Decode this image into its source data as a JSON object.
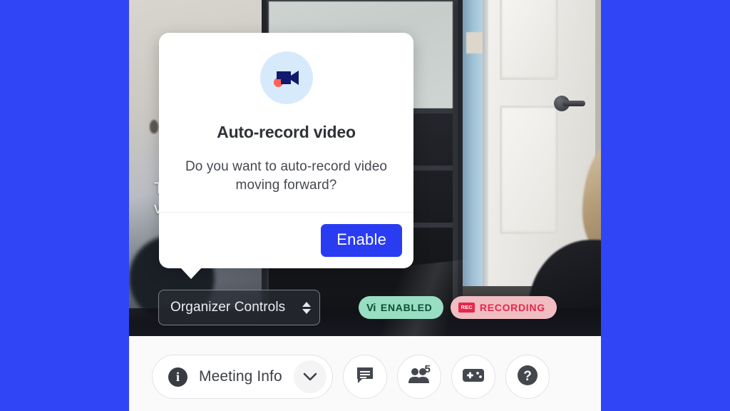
{
  "theme": {
    "letterbox_color": "#3045F5",
    "accent_blue": "#2a3cf2",
    "enabled_badge_bg": "#98dec3",
    "enabled_badge_fg": "#0d4d39",
    "recording_badge_bg": "#f0bdc2",
    "recording_badge_fg": "#e8274a",
    "dialog_icon_bg": "#d7eafc",
    "toolbar_bg": "#fafafa"
  },
  "video": {
    "obscured_caption_line1": "T",
    "obscured_caption_line2": "v"
  },
  "dialog": {
    "icon_name": "video-camera-record-icon",
    "title": "Auto-record video",
    "body": "Do you want to auto-record video moving forward?",
    "primary_button": "Enable"
  },
  "controls": {
    "select_value": "Organizer Controls",
    "select_icon": "stepper-arrows-icon"
  },
  "status_badges": [
    {
      "mark": "Vi",
      "label": "ENABLED",
      "icon_name": "vi-logo-icon"
    },
    {
      "mark": "REC",
      "label": "RECORDING",
      "icon_name": "rec-chip-icon"
    }
  ],
  "toolbar": {
    "meeting_info": {
      "icon_name": "info-circle-icon",
      "label": "Meeting Info",
      "chevron_icon": "chevron-down-icon"
    },
    "buttons": [
      {
        "icon_name": "chat-bubble-icon",
        "count": ""
      },
      {
        "icon_name": "people-icon",
        "count": "5"
      },
      {
        "icon_name": "game-controller-icon",
        "count": ""
      },
      {
        "icon_name": "help-question-icon",
        "count": ""
      }
    ]
  }
}
